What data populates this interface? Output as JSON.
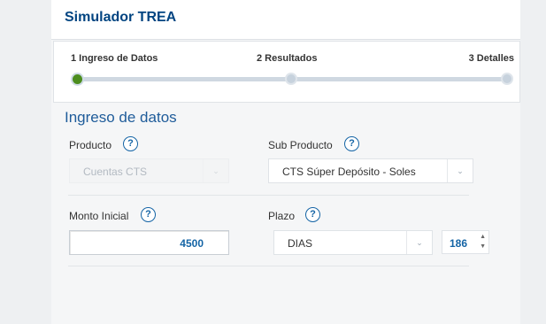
{
  "header": {
    "title": "Simulador TREA"
  },
  "stepper": {
    "steps": [
      {
        "label": "1 Ingreso de Datos"
      },
      {
        "label": "2 Resultados"
      },
      {
        "label": "3 Detalles"
      }
    ],
    "active_step": 1
  },
  "form": {
    "section_title": "Ingreso de datos",
    "producto": {
      "label": "Producto",
      "value": "Cuentas CTS",
      "disabled": true
    },
    "sub_producto": {
      "label": "Sub Producto",
      "value": "CTS Súper Depósito - Soles"
    },
    "monto_inicial": {
      "label": "Monto Inicial",
      "value": "4500"
    },
    "plazo": {
      "label": "Plazo",
      "unit_value": "DIAS",
      "days_value": "186"
    },
    "help_glyph": "?"
  },
  "colors": {
    "brand": "#004481",
    "accent": "#1464a5",
    "active_step": "#4c8d1f"
  }
}
